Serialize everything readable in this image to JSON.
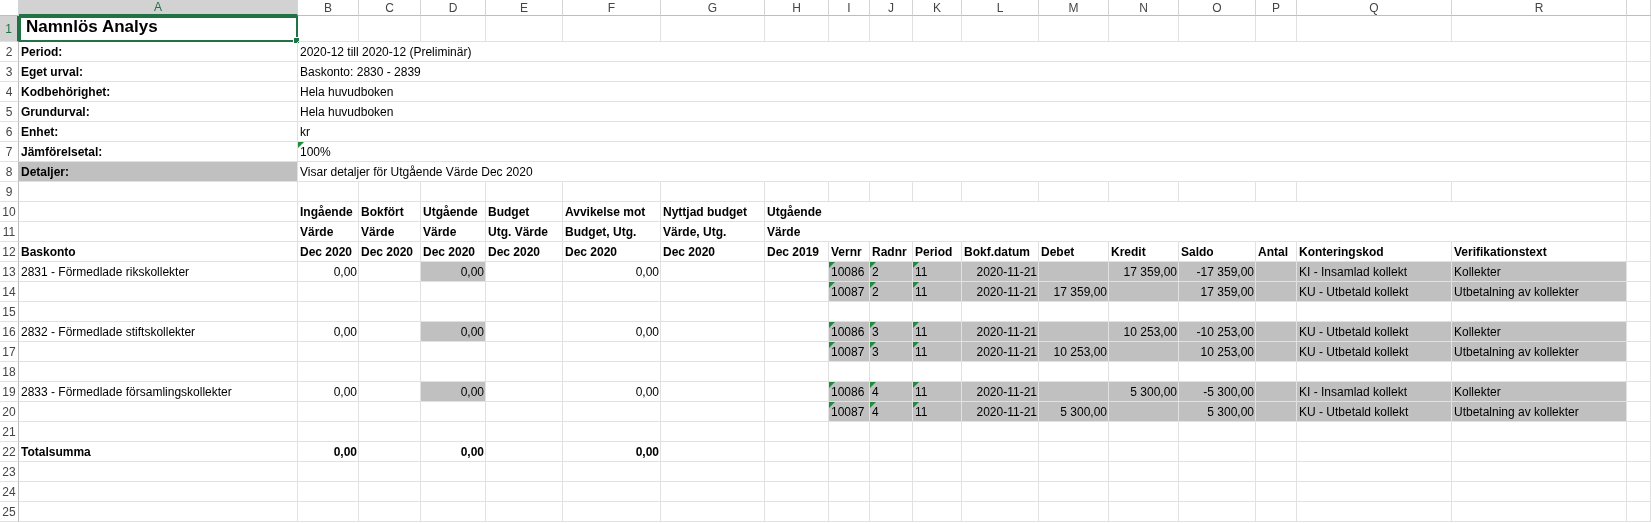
{
  "columns": [
    {
      "label": "A",
      "selected": true
    },
    {
      "label": "B",
      "selected": false
    },
    {
      "label": "C",
      "selected": false
    },
    {
      "label": "D",
      "selected": false
    },
    {
      "label": "E",
      "selected": false
    },
    {
      "label": "F",
      "selected": false
    },
    {
      "label": "G",
      "selected": false
    },
    {
      "label": "H",
      "selected": false
    },
    {
      "label": "I",
      "selected": false
    },
    {
      "label": "J",
      "selected": false
    },
    {
      "label": "K",
      "selected": false
    },
    {
      "label": "L",
      "selected": false
    },
    {
      "label": "M",
      "selected": false
    },
    {
      "label": "N",
      "selected": false
    },
    {
      "label": "O",
      "selected": false
    },
    {
      "label": "P",
      "selected": false
    },
    {
      "label": "Q",
      "selected": false
    },
    {
      "label": "R",
      "selected": false
    }
  ],
  "rows": [
    {
      "number": "1",
      "selected": true,
      "highlight": false,
      "cells": {
        "A": {
          "text": "Namnlös Analys",
          "kind": "title",
          "shaded": false
        }
      }
    },
    {
      "number": "2",
      "selected": false,
      "highlight": false,
      "cells": {
        "A": {
          "text": "Period:",
          "kind": "label",
          "shaded": false
        },
        "B": {
          "text": "2020-12 till 2020-12 (Preliminär)",
          "kind": "text",
          "shaded": false
        }
      }
    },
    {
      "number": "3",
      "selected": false,
      "highlight": false,
      "cells": {
        "A": {
          "text": "Eget urval:",
          "kind": "label",
          "shaded": false
        },
        "B": {
          "text": "Baskonto: 2830 - 2839",
          "kind": "text",
          "shaded": false
        }
      }
    },
    {
      "number": "4",
      "selected": false,
      "highlight": false,
      "cells": {
        "A": {
          "text": "Kodbehörighet:",
          "kind": "label",
          "shaded": false
        },
        "B": {
          "text": "Hela huvudboken",
          "kind": "text",
          "shaded": false
        }
      }
    },
    {
      "number": "5",
      "selected": false,
      "highlight": false,
      "cells": {
        "A": {
          "text": "Grundurval:",
          "kind": "label",
          "shaded": false
        },
        "B": {
          "text": "Hela huvudboken",
          "kind": "text",
          "shaded": false
        }
      }
    },
    {
      "number": "6",
      "selected": false,
      "highlight": false,
      "cells": {
        "A": {
          "text": "Enhet:",
          "kind": "label",
          "shaded": false
        },
        "B": {
          "text": "kr",
          "kind": "text",
          "shaded": false
        }
      }
    },
    {
      "number": "7",
      "selected": false,
      "highlight": false,
      "cells": {
        "A": {
          "text": "Jämförelsetal:",
          "kind": "label",
          "shaded": false
        },
        "B": {
          "text": "100%",
          "kind": "text_number",
          "shaded": false
        }
      }
    },
    {
      "number": "8",
      "selected": false,
      "highlight": false,
      "cells": {
        "A": {
          "text": "Detaljer:",
          "kind": "label",
          "shaded": true
        },
        "B": {
          "text": "Visar detaljer för Utgående Värde Dec 2020",
          "kind": "text",
          "shaded": false
        }
      }
    },
    {
      "number": "9",
      "selected": false,
      "highlight": false,
      "cells": {}
    },
    {
      "number": "10",
      "selected": false,
      "highlight": false,
      "cells": {
        "B": {
          "text": "Ingående",
          "kind": "label",
          "shaded": false
        },
        "C": {
          "text": "Bokfört",
          "kind": "label",
          "shaded": false
        },
        "D": {
          "text": "Utgående",
          "kind": "label",
          "shaded": false
        },
        "E": {
          "text": "Budget",
          "kind": "label",
          "shaded": false
        },
        "F": {
          "text": "Avvikelse mot",
          "kind": "label",
          "shaded": false
        },
        "G": {
          "text": "Nyttjad budget",
          "kind": "label",
          "shaded": false
        },
        "H": {
          "text": "Utgående",
          "kind": "label",
          "shaded": false
        }
      }
    },
    {
      "number": "11",
      "selected": false,
      "highlight": false,
      "cells": {
        "B": {
          "text": "Värde",
          "kind": "label",
          "shaded": false
        },
        "C": {
          "text": "Värde",
          "kind": "label",
          "shaded": false
        },
        "D": {
          "text": "Värde",
          "kind": "label",
          "shaded": false
        },
        "E": {
          "text": "Utg. Värde",
          "kind": "label",
          "shaded": false
        },
        "F": {
          "text": "Budget, Utg.",
          "kind": "label",
          "shaded": false
        },
        "G": {
          "text": "Värde, Utg.",
          "kind": "label",
          "shaded": false
        },
        "H": {
          "text": "Värde",
          "kind": "label",
          "shaded": false
        }
      }
    },
    {
      "number": "12",
      "selected": false,
      "highlight": false,
      "cells": {
        "A": {
          "text": "Baskonto",
          "kind": "label",
          "shaded": false
        },
        "B": {
          "text": "Dec 2020",
          "kind": "label",
          "shaded": false
        },
        "C": {
          "text": "Dec 2020",
          "kind": "label",
          "shaded": false
        },
        "D": {
          "text": "Dec 2020",
          "kind": "label",
          "shaded": false
        },
        "E": {
          "text": "Dec 2020",
          "kind": "label",
          "shaded": false
        },
        "F": {
          "text": "Dec 2020",
          "kind": "label",
          "shaded": false
        },
        "G": {
          "text": "Dec 2020",
          "kind": "label",
          "shaded": false
        },
        "H": {
          "text": "Dec 2019",
          "kind": "label",
          "shaded": false
        },
        "I": {
          "text": "Vernr",
          "kind": "label",
          "shaded": false
        },
        "J": {
          "text": "Radnr",
          "kind": "label",
          "shaded": false
        },
        "K": {
          "text": "Period",
          "kind": "label",
          "shaded": false
        },
        "L": {
          "text": "Bokf.datum",
          "kind": "label",
          "shaded": false
        },
        "M": {
          "text": "Debet",
          "kind": "label",
          "shaded": false
        },
        "N": {
          "text": "Kredit",
          "kind": "label",
          "shaded": false
        },
        "O": {
          "text": "Saldo",
          "kind": "label",
          "shaded": false
        },
        "P": {
          "text": "Antal",
          "kind": "label",
          "shaded": false
        },
        "Q": {
          "text": "Konteringskod",
          "kind": "label",
          "shaded": false
        },
        "R": {
          "text": "Verifikationstext",
          "kind": "label",
          "shaded": false
        }
      }
    },
    {
      "number": "13",
      "selected": false,
      "highlight": true,
      "cells": {
        "A": {
          "text": "2831 - Förmedlade rikskollekter",
          "kind": "text",
          "shaded": false
        },
        "B": {
          "text": "0,00",
          "kind": "number",
          "shaded": false
        },
        "D": {
          "text": "0,00",
          "kind": "number",
          "shaded": true
        },
        "F": {
          "text": "0,00",
          "kind": "number",
          "shaded": false
        },
        "I": {
          "text": "10086",
          "kind": "text_number",
          "shaded": true
        },
        "J": {
          "text": "2",
          "kind": "text_number",
          "shaded": true
        },
        "K": {
          "text": "11",
          "kind": "text_number",
          "shaded": true
        },
        "L": {
          "text": "2020-11-21",
          "kind": "number",
          "shaded": true
        },
        "N": {
          "text": "17 359,00",
          "kind": "number",
          "shaded": true
        },
        "O": {
          "text": "-17 359,00",
          "kind": "number",
          "shaded": true
        },
        "Q": {
          "text": "KI - Insamlad kollekt",
          "kind": "text",
          "shaded": true
        },
        "R": {
          "text": "Kollekter",
          "kind": "text",
          "shaded": true
        }
      }
    },
    {
      "number": "14",
      "selected": false,
      "highlight": true,
      "cells": {
        "I": {
          "text": "10087",
          "kind": "text_number",
          "shaded": true
        },
        "J": {
          "text": "2",
          "kind": "text_number",
          "shaded": true
        },
        "K": {
          "text": "11",
          "kind": "text_number",
          "shaded": true
        },
        "L": {
          "text": "2020-11-21",
          "kind": "number",
          "shaded": true
        },
        "M": {
          "text": "17 359,00",
          "kind": "number",
          "shaded": true
        },
        "O": {
          "text": "17 359,00",
          "kind": "number",
          "shaded": true
        },
        "Q": {
          "text": "KU - Utbetald kollekt",
          "kind": "text",
          "shaded": true
        },
        "R": {
          "text": "Utbetalning av kollekter",
          "kind": "text",
          "shaded": true
        }
      }
    },
    {
      "number": "15",
      "selected": false,
      "highlight": false,
      "cells": {}
    },
    {
      "number": "16",
      "selected": false,
      "highlight": true,
      "cells": {
        "A": {
          "text": "2832 - Förmedlade stiftskollekter",
          "kind": "text",
          "shaded": false
        },
        "B": {
          "text": "0,00",
          "kind": "number",
          "shaded": false
        },
        "D": {
          "text": "0,00",
          "kind": "number",
          "shaded": true
        },
        "F": {
          "text": "0,00",
          "kind": "number",
          "shaded": false
        },
        "I": {
          "text": "10086",
          "kind": "text_number",
          "shaded": true
        },
        "J": {
          "text": "3",
          "kind": "text_number",
          "shaded": true
        },
        "K": {
          "text": "11",
          "kind": "text_number",
          "shaded": true
        },
        "L": {
          "text": "2020-11-21",
          "kind": "number",
          "shaded": true
        },
        "N": {
          "text": "10 253,00",
          "kind": "number",
          "shaded": true
        },
        "O": {
          "text": "-10 253,00",
          "kind": "number",
          "shaded": true
        },
        "Q": {
          "text": "KU - Utbetald kollekt",
          "kind": "text",
          "shaded": true
        },
        "R": {
          "text": "Kollekter",
          "kind": "text",
          "shaded": true
        }
      }
    },
    {
      "number": "17",
      "selected": false,
      "highlight": true,
      "cells": {
        "I": {
          "text": "10087",
          "kind": "text_number",
          "shaded": true
        },
        "J": {
          "text": "3",
          "kind": "text_number",
          "shaded": true
        },
        "K": {
          "text": "11",
          "kind": "text_number",
          "shaded": true
        },
        "L": {
          "text": "2020-11-21",
          "kind": "number",
          "shaded": true
        },
        "M": {
          "text": "10 253,00",
          "kind": "number",
          "shaded": true
        },
        "O": {
          "text": "10 253,00",
          "kind": "number",
          "shaded": true
        },
        "Q": {
          "text": "KU - Utbetald kollekt",
          "kind": "text",
          "shaded": true
        },
        "R": {
          "text": "Utbetalning av kollekter",
          "kind": "text",
          "shaded": true
        }
      }
    },
    {
      "number": "18",
      "selected": false,
      "highlight": false,
      "cells": {}
    },
    {
      "number": "19",
      "selected": false,
      "highlight": true,
      "cells": {
        "A": {
          "text": "2833 - Förmedlade församlingskollekter",
          "kind": "text",
          "shaded": false
        },
        "B": {
          "text": "0,00",
          "kind": "number",
          "shaded": false
        },
        "D": {
          "text": "0,00",
          "kind": "number",
          "shaded": true
        },
        "F": {
          "text": "0,00",
          "kind": "number",
          "shaded": false
        },
        "I": {
          "text": "10086",
          "kind": "text_number",
          "shaded": true
        },
        "J": {
          "text": "4",
          "kind": "text_number",
          "shaded": true
        },
        "K": {
          "text": "11",
          "kind": "text_number",
          "shaded": true
        },
        "L": {
          "text": "2020-11-21",
          "kind": "number",
          "shaded": true
        },
        "N": {
          "text": "5 300,00",
          "kind": "number",
          "shaded": true
        },
        "O": {
          "text": "-5 300,00",
          "kind": "number",
          "shaded": true
        },
        "Q": {
          "text": "KI - Insamlad kollekt",
          "kind": "text",
          "shaded": true
        },
        "R": {
          "text": "Kollekter",
          "kind": "text",
          "shaded": true
        }
      }
    },
    {
      "number": "20",
      "selected": false,
      "highlight": true,
      "cells": {
        "I": {
          "text": "10087",
          "kind": "text_number",
          "shaded": true
        },
        "J": {
          "text": "4",
          "kind": "text_number",
          "shaded": true
        },
        "K": {
          "text": "11",
          "kind": "text_number",
          "shaded": true
        },
        "L": {
          "text": "2020-11-21",
          "kind": "number",
          "shaded": true
        },
        "M": {
          "text": "5 300,00",
          "kind": "number",
          "shaded": true
        },
        "O": {
          "text": "5 300,00",
          "kind": "number",
          "shaded": true
        },
        "Q": {
          "text": "KU - Utbetald kollekt",
          "kind": "text",
          "shaded": true
        },
        "R": {
          "text": "Utbetalning av kollekter",
          "kind": "text",
          "shaded": true
        }
      }
    },
    {
      "number": "21",
      "selected": false,
      "highlight": false,
      "cells": {}
    },
    {
      "number": "22",
      "selected": false,
      "highlight": false,
      "cells": {
        "A": {
          "text": "Totalsumma",
          "kind": "label",
          "shaded": false
        },
        "B": {
          "text": "0,00",
          "kind": "total",
          "shaded": false
        },
        "D": {
          "text": "0,00",
          "kind": "total",
          "shaded": false
        },
        "F": {
          "text": "0,00",
          "kind": "total",
          "shaded": false
        }
      }
    },
    {
      "number": "23",
      "selected": false,
      "highlight": false,
      "cells": {}
    },
    {
      "number": "24",
      "selected": false,
      "highlight": false,
      "cells": {}
    },
    {
      "number": "25",
      "selected": false,
      "highlight": false,
      "cells": {}
    }
  ]
}
